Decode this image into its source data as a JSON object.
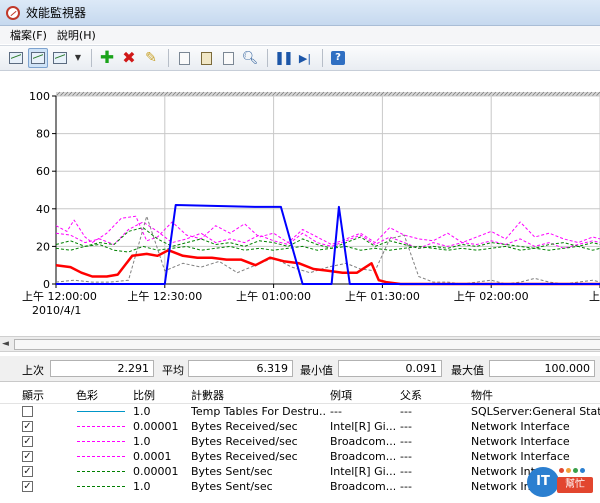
{
  "window": {
    "title": "效能監視器"
  },
  "menu": [
    {
      "label": "檔案(F)"
    },
    {
      "label": "說明(H)"
    }
  ],
  "toolbar": {
    "icons": [
      "view-graph-icon",
      "view-current-activity-icon",
      "change-graph-type-icon",
      "dropdown-icon",
      "add-counter-icon",
      "delete-counter-icon",
      "highlight-icon",
      "copy-properties-icon",
      "paste-counter-list-icon",
      "properties-icon",
      "zoom-icon",
      "freeze-display-icon",
      "update-data-icon",
      "help-icon"
    ],
    "help_label": "?"
  },
  "chart_data": {
    "type": "line",
    "ylim": [
      0,
      100
    ],
    "yticks": [
      "100",
      "80",
      "60",
      "40",
      "20",
      "0"
    ],
    "grid": true,
    "xticks": [
      {
        "t": 0,
        "line1": "上午 12:00:00",
        "line2": "2010/4/1"
      },
      {
        "t": 30,
        "line1": "上午 12:30:00",
        "line2": ""
      },
      {
        "t": 60,
        "line1": "上午 01:00:00",
        "line2": ""
      },
      {
        "t": 90,
        "line1": "上午 01:30:00",
        "line2": ""
      },
      {
        "t": 120,
        "line1": "上午 02:00:00",
        "line2": ""
      },
      {
        "t": 150,
        "line1": "上午",
        "line2": ""
      }
    ],
    "xlim": [
      0,
      150
    ],
    "series": [
      {
        "color": "#ff00ff",
        "dash": "3,2",
        "width": 1,
        "x": [
          0,
          3,
          5,
          8,
          10,
          14,
          18,
          22,
          25,
          28,
          32,
          36,
          40,
          44,
          48,
          52,
          56,
          60,
          64,
          68,
          72,
          76,
          80,
          84,
          88,
          92,
          96,
          100,
          104,
          108,
          112,
          116,
          120,
          124,
          128,
          132,
          136,
          140,
          144,
          148,
          150
        ],
        "y": [
          31,
          28,
          34,
          25,
          22,
          27,
          35,
          36,
          23,
          25,
          33,
          26,
          24,
          31,
          27,
          32,
          25,
          27,
          22,
          29,
          25,
          21,
          24,
          27,
          22,
          30,
          26,
          24,
          23,
          27,
          22,
          25,
          28,
          24,
          33,
          25,
          27,
          24,
          22,
          25,
          24
        ]
      },
      {
        "color": "#ff00ff",
        "dash": "3,2",
        "width": 1,
        "x": [
          0,
          4,
          8,
          12,
          16,
          20,
          24,
          28,
          32,
          36,
          40,
          44,
          48,
          52,
          56,
          60,
          64,
          68,
          72,
          76,
          80,
          84,
          88,
          92,
          96,
          100,
          104,
          108,
          112,
          116,
          120,
          124,
          128,
          132,
          136,
          140,
          144,
          148,
          150
        ],
        "y": [
          27,
          26,
          22,
          24,
          21,
          29,
          33,
          28,
          22,
          24,
          27,
          22,
          24,
          22,
          26,
          23,
          21,
          27,
          22,
          20,
          23,
          26,
          21,
          25,
          22,
          19,
          22,
          20,
          22,
          21,
          23,
          21,
          24,
          20,
          22,
          19,
          21,
          23,
          22
        ]
      },
      {
        "color": "#008000",
        "dash": "3,2",
        "width": 1,
        "x": [
          0,
          4,
          8,
          12,
          16,
          20,
          24,
          28,
          32,
          36,
          40,
          44,
          48,
          52,
          56,
          60,
          64,
          68,
          72,
          76,
          80,
          84,
          88,
          92,
          96,
          100,
          104,
          108,
          112,
          116,
          120,
          124,
          128,
          132,
          136,
          140,
          144,
          148,
          150
        ],
        "y": [
          21,
          23,
          20,
          22,
          21,
          28,
          30,
          24,
          20,
          22,
          24,
          21,
          22,
          20,
          23,
          22,
          20,
          24,
          21,
          19,
          22,
          25,
          20,
          23,
          21,
          19,
          20,
          19,
          21,
          20,
          22,
          21,
          20,
          19,
          21,
          22,
          20,
          22,
          21
        ]
      },
      {
        "color": "#008000",
        "dash": "3,2",
        "width": 1,
        "x": [
          0,
          4,
          8,
          12,
          16,
          20,
          24,
          28,
          32,
          36,
          40,
          44,
          48,
          52,
          56,
          60,
          64,
          68,
          72,
          76,
          80,
          84,
          88,
          92,
          96,
          100,
          104,
          108,
          112,
          116,
          120,
          124,
          128,
          132,
          136,
          140,
          144,
          148,
          150
        ],
        "y": [
          19,
          18,
          20,
          21,
          18,
          17,
          20,
          18,
          19,
          20,
          18,
          19,
          20,
          18,
          19,
          18,
          19,
          20,
          18,
          19,
          20,
          18,
          19,
          18,
          19,
          20,
          19,
          18,
          19,
          18,
          19,
          20,
          18,
          19,
          18,
          19,
          20,
          18,
          19
        ]
      },
      {
        "color": "#808080",
        "dash": "3,2",
        "width": 1,
        "x": [
          0,
          5,
          10,
          15,
          20,
          25,
          30,
          35,
          40,
          45,
          50,
          55,
          60,
          65,
          70,
          75,
          80,
          84,
          88,
          92,
          96,
          100,
          104,
          108,
          112,
          116,
          120,
          124,
          128,
          132,
          136,
          140,
          144,
          148,
          150
        ],
        "y": [
          1,
          2,
          1,
          1,
          2,
          36,
          7,
          11,
          9,
          12,
          6,
          10,
          14,
          9,
          6,
          9,
          11,
          8,
          7,
          24,
          26,
          4,
          1,
          1,
          0,
          1,
          2,
          0,
          1,
          3,
          1,
          0,
          1,
          2,
          1
        ]
      },
      {
        "color": "#ff0000",
        "dash": "",
        "width": 2.5,
        "x": [
          0,
          4,
          7,
          10,
          14,
          17,
          21,
          25,
          28,
          31,
          35,
          39,
          43,
          47,
          51,
          55,
          59,
          63,
          67,
          71,
          75,
          79,
          83,
          87,
          89,
          91,
          95,
          100,
          110,
          120,
          130,
          140,
          150
        ],
        "y": [
          10,
          9,
          6,
          4,
          4,
          5,
          15,
          16,
          15,
          18,
          15,
          14,
          14,
          13,
          13,
          10,
          14,
          12,
          11,
          8,
          7,
          6,
          6,
          11,
          2,
          1,
          0,
          0,
          0,
          0,
          0,
          0,
          0
        ]
      },
      {
        "color": "#0000ff",
        "dash": "",
        "width": 2,
        "x": [
          0,
          20,
          26,
          30,
          33,
          55,
          62,
          68,
          72,
          76,
          78,
          81,
          85,
          100,
          110,
          120,
          130,
          140,
          150
        ],
        "y": [
          0,
          0,
          0,
          0,
          42,
          41,
          41,
          0,
          0,
          0,
          41,
          0,
          0,
          0,
          0,
          0,
          0,
          0,
          0
        ]
      }
    ]
  },
  "scroll_arrow": "◄",
  "stats": {
    "last_label": "上次",
    "last_value": "2.291",
    "avg_label": "平均",
    "avg_value": "6.319",
    "min_label": "最小值",
    "min_value": "0.091",
    "max_label": "最大值",
    "max_value": "100.000"
  },
  "table": {
    "headers": {
      "show": "顯示",
      "color": "色彩",
      "scale": "比例",
      "counter": "計數器",
      "instance": "例項",
      "parent": "父系",
      "object": "物件"
    },
    "rows": [
      {
        "checked": false,
        "color": "#0096c8",
        "scale": "1.0",
        "counter": "Temp Tables For Destru...",
        "instance": "---",
        "parent": "---",
        "object": "SQLServer:General Stati..."
      },
      {
        "checked": true,
        "color": "#ff00ff",
        "scale": "0.00001",
        "counter": "Bytes Received/sec",
        "instance": "Intel[R] Gi...",
        "parent": "---",
        "object": "Network Interface"
      },
      {
        "checked": true,
        "color": "#ff00ff",
        "scale": "1.0",
        "counter": "Bytes Received/sec",
        "instance": "Broadcom...",
        "parent": "---",
        "object": "Network Interface"
      },
      {
        "checked": true,
        "color": "#ff00ff",
        "scale": "0.0001",
        "counter": "Bytes Received/sec",
        "instance": "Broadcom...",
        "parent": "---",
        "object": "Network Interface"
      },
      {
        "checked": true,
        "color": "#008000",
        "scale": "0.00001",
        "counter": "Bytes Sent/sec",
        "instance": "Intel[R] Gi...",
        "parent": "---",
        "object": "Network Inter"
      },
      {
        "checked": true,
        "color": "#008000",
        "scale": "1.0",
        "counter": "Bytes Sent/sec",
        "instance": "Broadcom...",
        "parent": "---",
        "object": "Network Inter"
      }
    ]
  },
  "watermark": {
    "badge": "IT",
    "tag": "幫忙"
  }
}
